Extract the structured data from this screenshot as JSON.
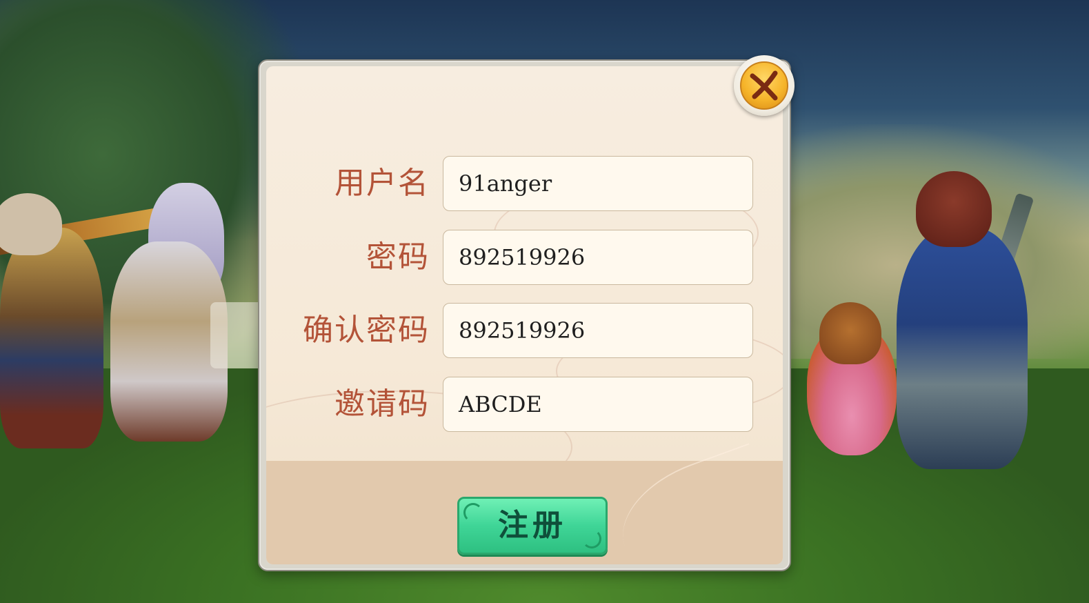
{
  "dialog": {
    "fields": [
      {
        "label": "用户名",
        "value": "91anger"
      },
      {
        "label": "密码",
        "value": "892519926"
      },
      {
        "label": "确认密码",
        "value": "892519926"
      },
      {
        "label": "邀请码",
        "value": "ABCDE"
      }
    ],
    "register_label": "注册",
    "close_icon": "close-icon"
  },
  "colors": {
    "label": "#b35338",
    "register_button": "#3fd597",
    "close_button": "#f6b52b"
  }
}
